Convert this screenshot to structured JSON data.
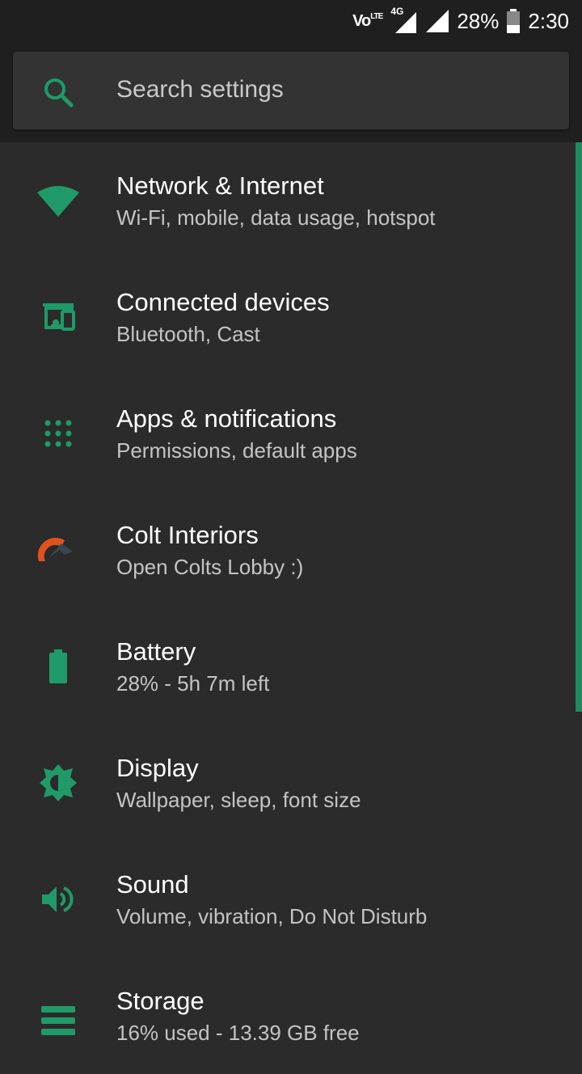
{
  "status_bar": {
    "volte": "Vo",
    "network": "4G",
    "battery_percent": "28%",
    "time": "2:30",
    "icons": [
      "volte-lte-icon",
      "signal-4g-icon",
      "signal-icon",
      "battery-icon"
    ]
  },
  "search": {
    "placeholder": "Search settings",
    "icon": "search-icon"
  },
  "colors": {
    "accent": "#1f8a5f",
    "background": "#2b2b2b",
    "header": "#1f1f1f"
  },
  "settings": [
    {
      "title": "Network & Internet",
      "subtitle": "Wi-Fi, mobile, data usage, hotspot",
      "icon": "wifi-icon"
    },
    {
      "title": "Connected devices",
      "subtitle": "Bluetooth, Cast",
      "icon": "devices-icon"
    },
    {
      "title": "Apps & notifications",
      "subtitle": "Permissions, default apps",
      "icon": "apps-grid-icon"
    },
    {
      "title": "Colt Interiors",
      "subtitle": "Open Colts Lobby :)",
      "icon": "colt-logo-icon"
    },
    {
      "title": "Battery",
      "subtitle": "28% - 5h 7m left",
      "icon": "battery-icon"
    },
    {
      "title": "Display",
      "subtitle": "Wallpaper, sleep, font size",
      "icon": "brightness-icon"
    },
    {
      "title": "Sound",
      "subtitle": "Volume, vibration, Do Not Disturb",
      "icon": "volume-icon"
    },
    {
      "title": "Storage",
      "subtitle": "16% used - 13.39 GB free",
      "icon": "storage-icon"
    }
  ]
}
